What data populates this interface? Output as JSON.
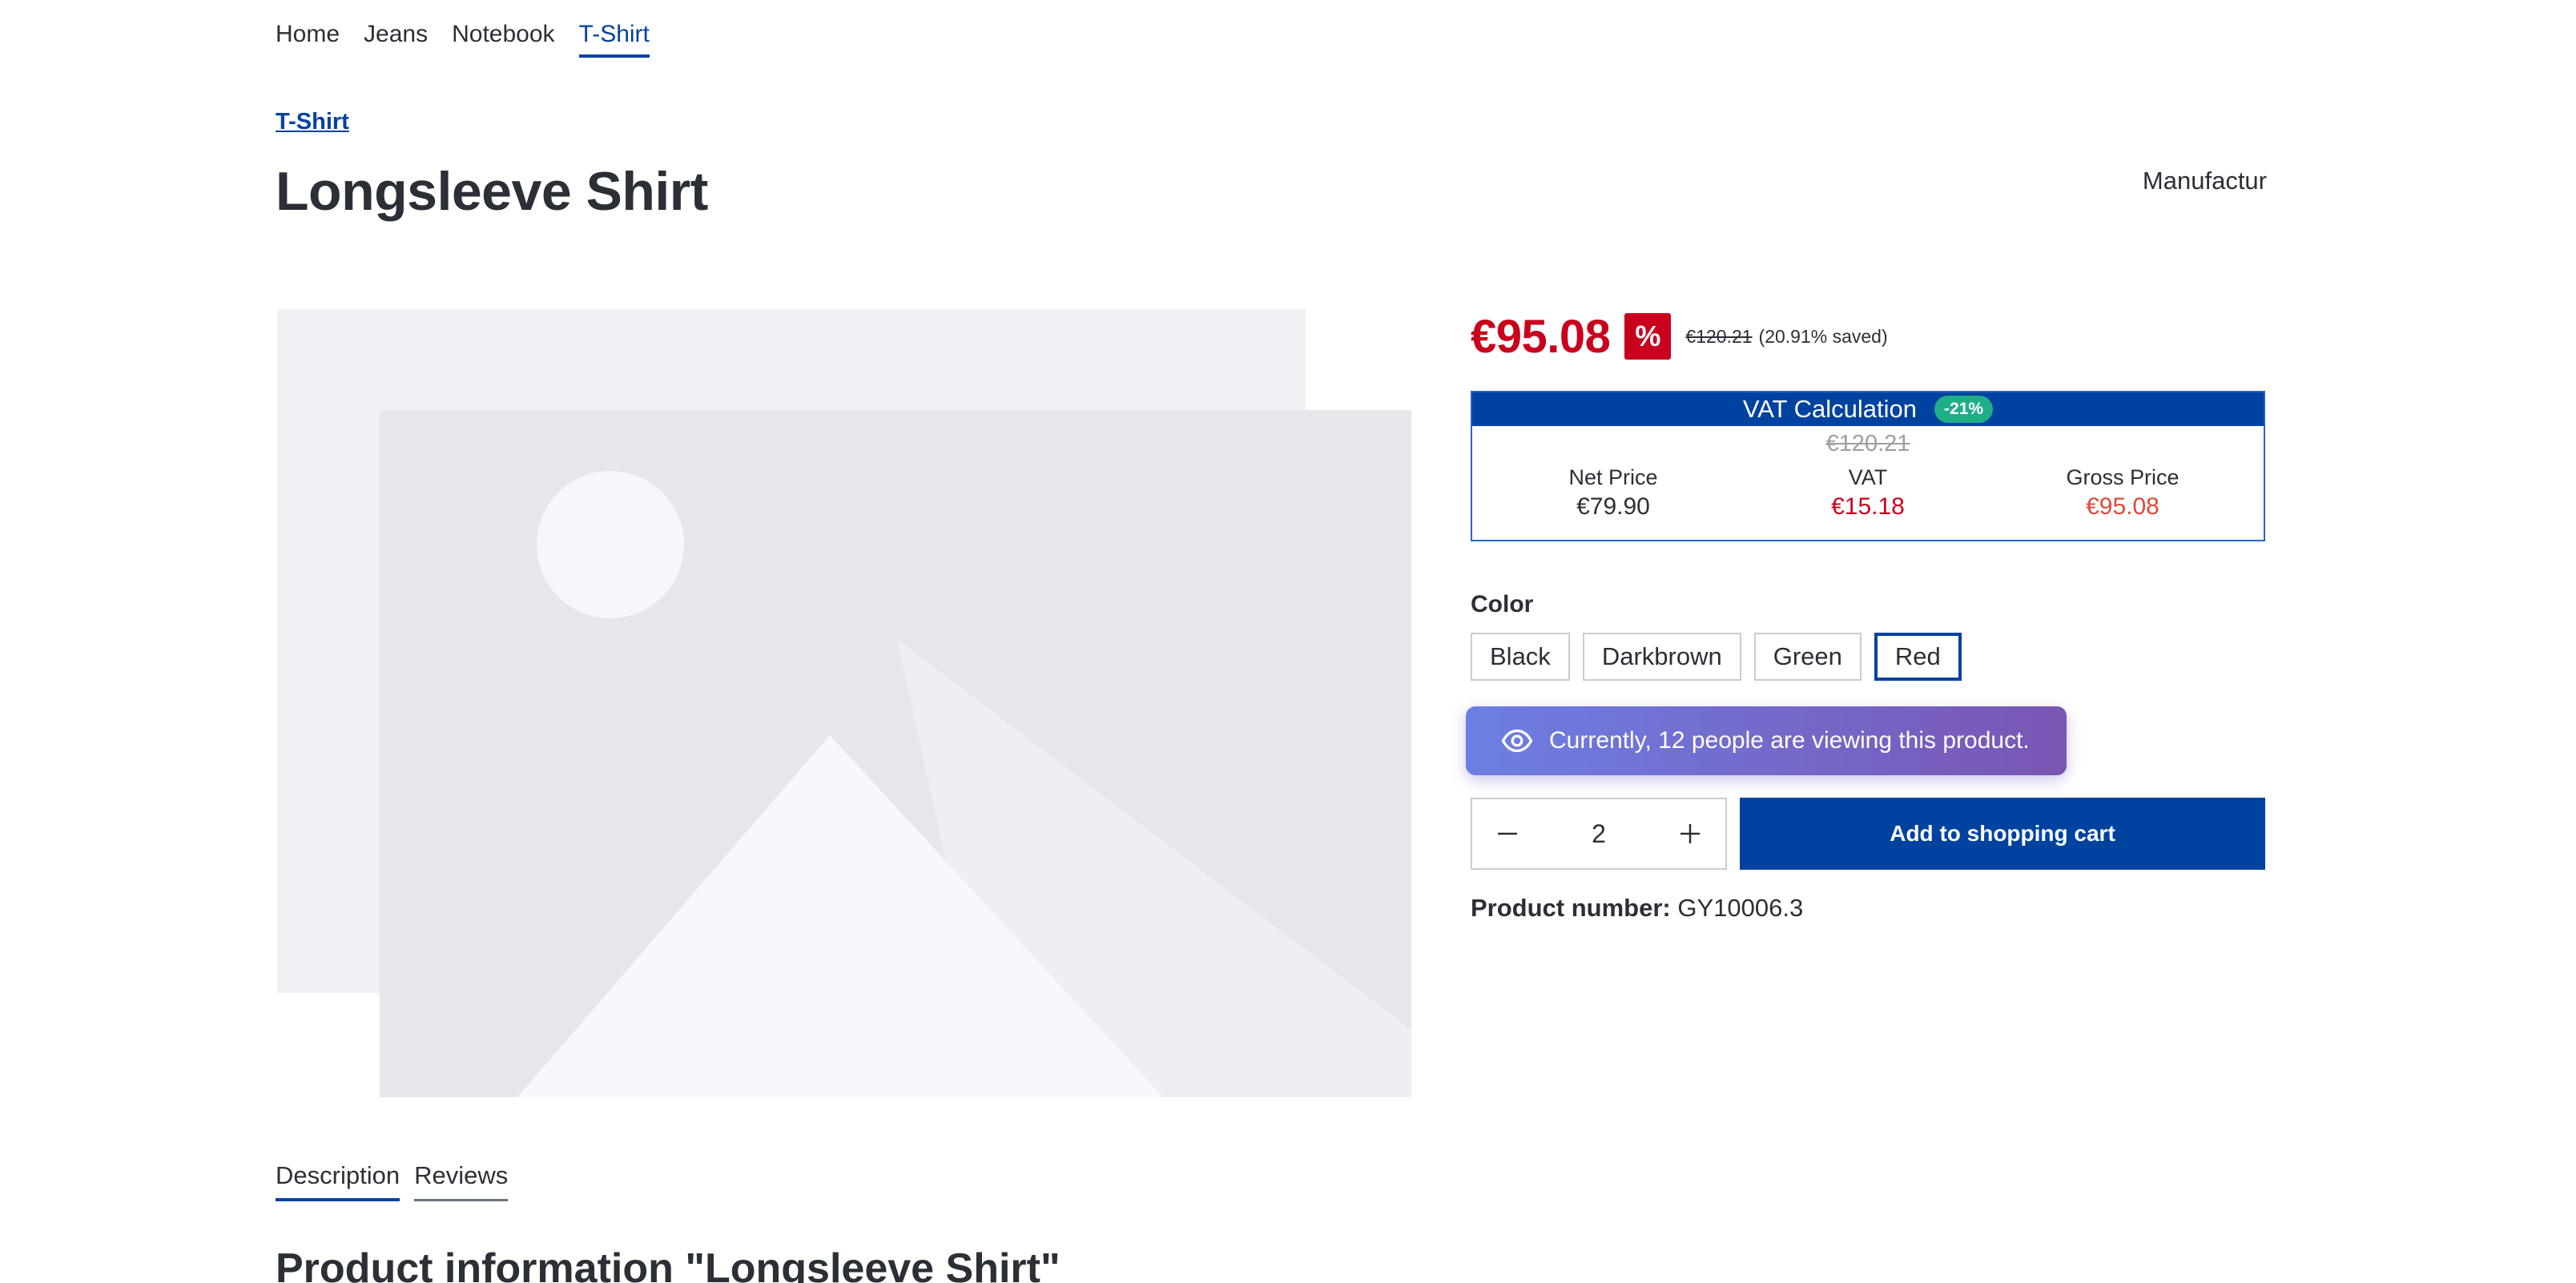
{
  "nav": {
    "items": [
      {
        "label": "Home"
      },
      {
        "label": "Jeans"
      },
      {
        "label": "Notebook"
      },
      {
        "label": "T-Shirt",
        "active": true
      }
    ]
  },
  "breadcrumb": {
    "label": "T-Shirt"
  },
  "product": {
    "title": "Longsleeve Shirt",
    "manufacturer": "Manufactur",
    "price": "€95.08",
    "discount_badge": "%",
    "original_price": "€120.21",
    "saved_text": "(20.91% saved)",
    "product_number_label": "Product number:",
    "product_number": "GY10006.3"
  },
  "vat_calc": {
    "title": "VAT Calculation",
    "badge": "-21%",
    "strike_price": "€120.21",
    "net_label": "Net Price",
    "net_value": "€79.90",
    "vat_label": "VAT",
    "vat_value": "€15.18",
    "gross_label": "Gross Price",
    "gross_value": "€95.08"
  },
  "color": {
    "label": "Color",
    "options": [
      "Black",
      "Darkbrown",
      "Green",
      "Red"
    ],
    "selected": "Red"
  },
  "viewers": {
    "text": "Currently, 12 people are viewing this product.",
    "icon": "eye-icon"
  },
  "cart": {
    "quantity": "2",
    "add_label": "Add to shopping cart"
  },
  "tabs": [
    {
      "label": "Description",
      "active": true
    },
    {
      "label": "Reviews"
    }
  ],
  "section": {
    "heading": "Product information \"Longsleeve Shirt\""
  },
  "colors": {
    "brand": "#0042a0",
    "sale_red": "#c8001d",
    "badge_green": "#1eaf87",
    "banner_start": "#6d7fe3",
    "banner_end": "#7a55b3"
  }
}
